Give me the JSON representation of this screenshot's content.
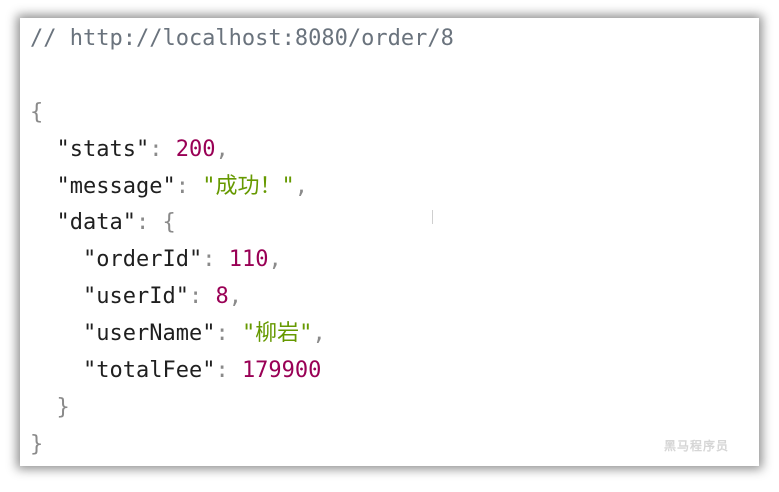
{
  "comment": "// http://localhost:8080/order/8",
  "json": {
    "stats_key": "\"stats\"",
    "stats_value": "200",
    "message_key": "\"message\"",
    "message_value": "\"成功！\"",
    "data_key": "\"data\"",
    "orderId_key": "\"orderId\"",
    "orderId_value": "110",
    "userId_key": "\"userId\"",
    "userId_value": "8",
    "userName_key": "\"userName\"",
    "userName_value": "\"柳岩\"",
    "totalFee_key": "\"totalFee\"",
    "totalFee_value": "179900"
  },
  "watermark": "黑马程序员",
  "colors": {
    "number": "#990055",
    "string": "#669900",
    "punctuation": "#8a8a8a",
    "comment": "#6a737d"
  }
}
